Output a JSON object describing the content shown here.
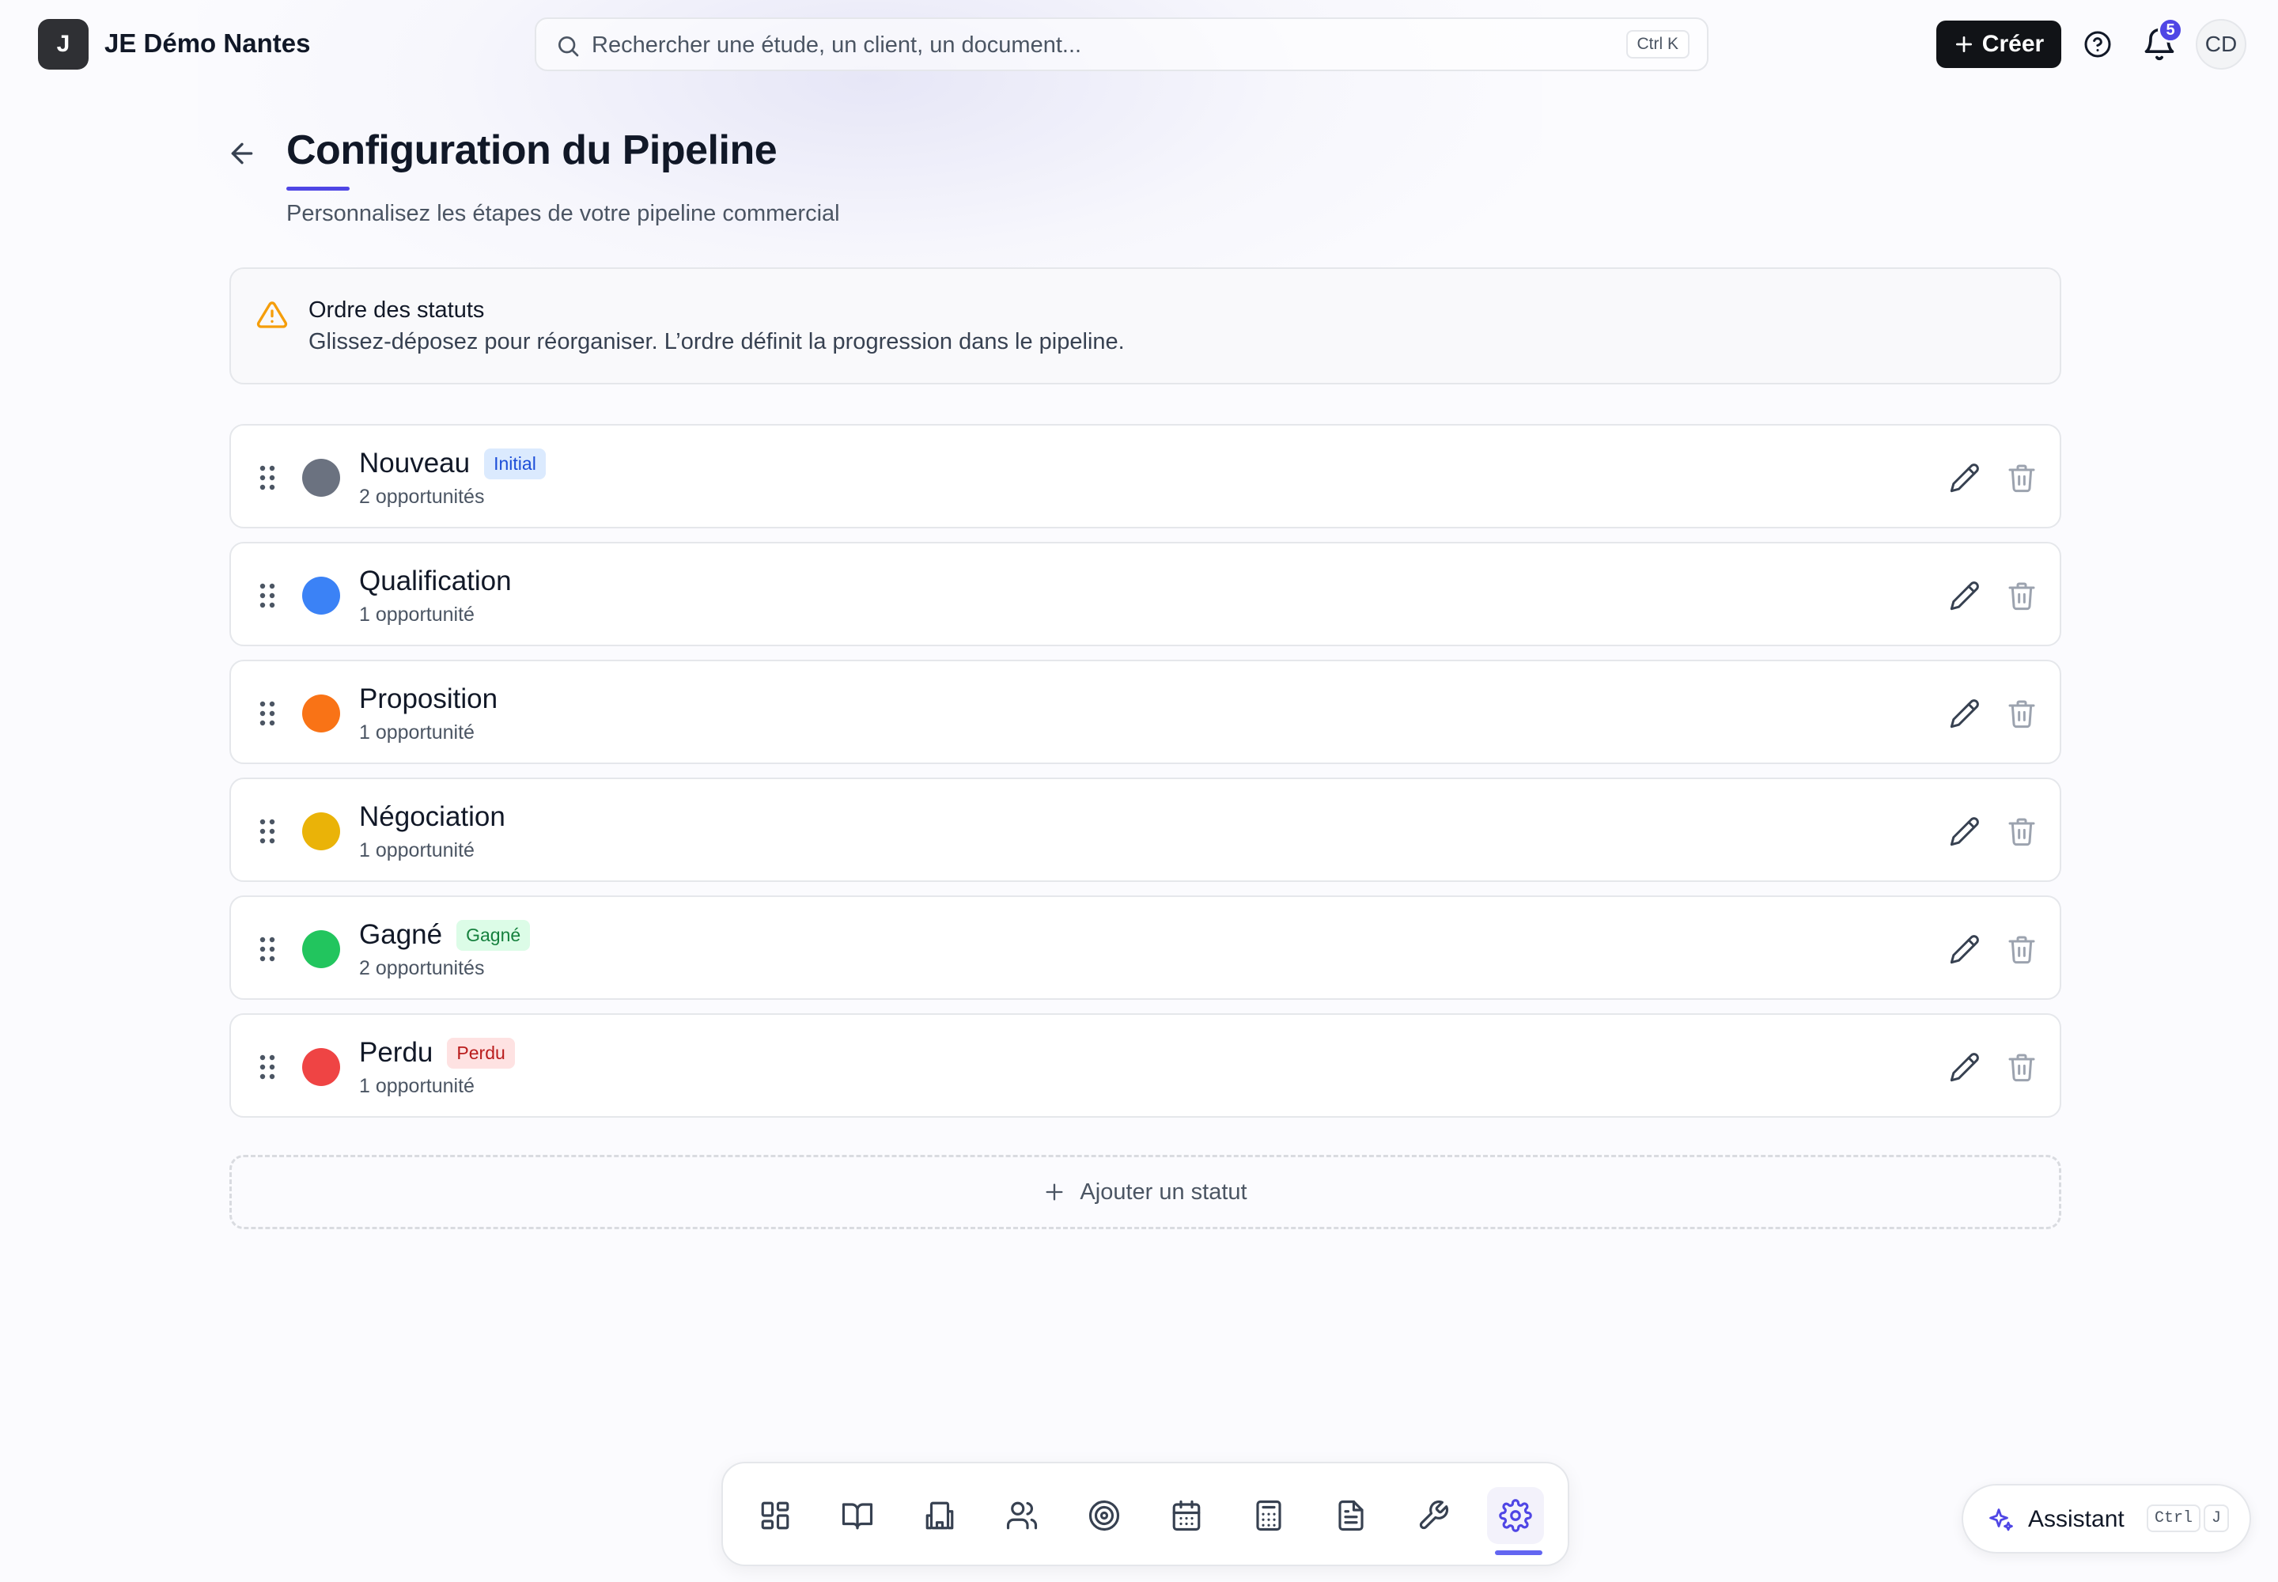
{
  "topbar": {
    "org_initial": "J",
    "org_name": "JE Démo Nantes",
    "search_placeholder": "Rechercher une étude, un client, un document...",
    "search_shortcut": "Ctrl K",
    "create_label": "Créer",
    "notifications_count": "5",
    "user_initials": "CD"
  },
  "header": {
    "title": "Configuration du Pipeline",
    "subtitle": "Personnalisez les étapes de votre pipeline commercial"
  },
  "info": {
    "title": "Ordre des statuts",
    "text": "Glissez-déposez pour réorganiser. L’ordre définit la progression dans le pipeline."
  },
  "statuses": [
    {
      "name": "Nouveau",
      "badge": "Initial",
      "count": "2 opportunités",
      "color": "#6b7280"
    },
    {
      "name": "Qualification",
      "badge": "",
      "count": "1 opportunité",
      "color": "#3b82f6"
    },
    {
      "name": "Proposition",
      "badge": "",
      "count": "1 opportunité",
      "color": "#f97316"
    },
    {
      "name": "Négociation",
      "badge": "",
      "count": "1 opportunité",
      "color": "#eab308"
    },
    {
      "name": "Gagné",
      "badge": "Gagné",
      "count": "2 opportunités",
      "color": "#22c55e"
    },
    {
      "name": "Perdu",
      "badge": "Perdu",
      "count": "1 opportunité",
      "color": "#ef4444"
    }
  ],
  "badge_styles": {
    "initial": {
      "bg": "#dbeafe",
      "fg": "#1d4ed8"
    },
    "won": {
      "bg": "#dcfce7",
      "fg": "#15803d"
    },
    "lost": {
      "bg": "#fee2e2",
      "fg": "#b91c1c"
    }
  },
  "add_status_label": "Ajouter un statut",
  "dock": {
    "items": [
      "dashboard-icon",
      "book-icon",
      "building-icon",
      "users-icon",
      "target-icon",
      "calendar-icon",
      "calculator-icon",
      "document-icon",
      "wrench-icon",
      "settings-icon"
    ],
    "active": "settings-icon"
  },
  "assistant": {
    "label": "Assistant",
    "shortcut_ctrl": "Ctrl",
    "shortcut_key": "J"
  },
  "colors": {
    "accent": "#4f46e5",
    "primary_button": "#111317",
    "warning": "#f59e0b"
  }
}
